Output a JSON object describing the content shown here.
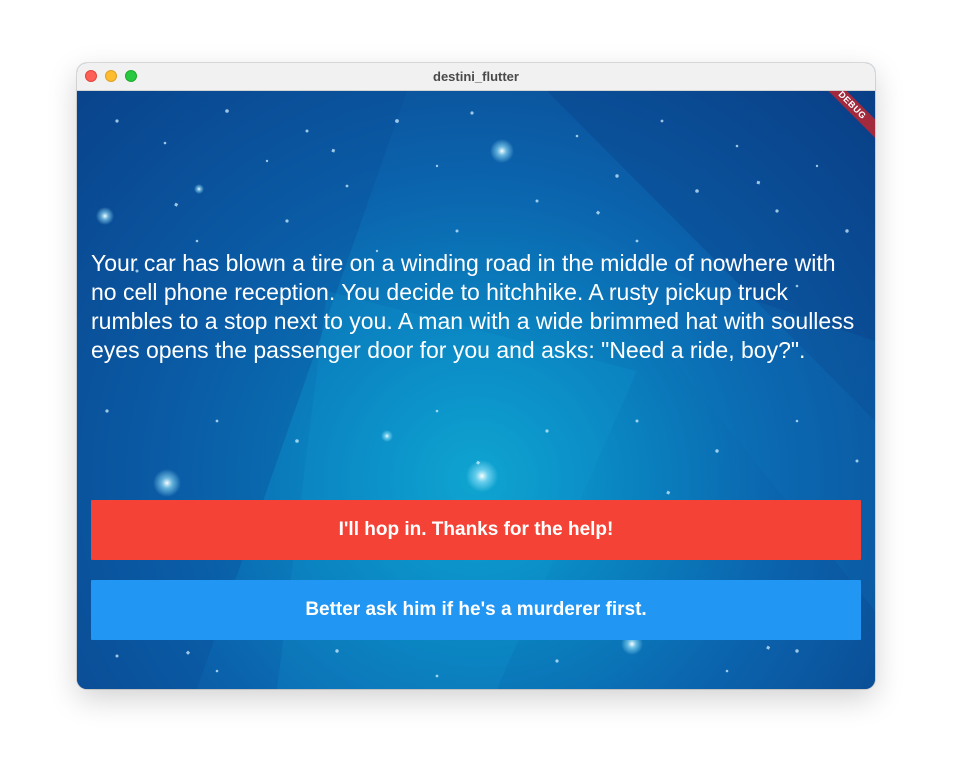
{
  "window": {
    "title": "destini_flutter",
    "controls": [
      "close",
      "minimize",
      "zoom"
    ]
  },
  "debug_banner": "DEBUG",
  "story": {
    "text": "Your car has blown a tire on a winding road in the middle of nowhere with no cell phone reception. You decide to hitchhike. A rusty pickup truck rumbles to a stop next to you. A man with a wide brimmed hat with soulless eyes opens the passenger door for you and asks: \"Need a ride, boy?\"."
  },
  "choices": {
    "choice1": {
      "label": "I'll hop in. Thanks for the help!",
      "color": "#f44336"
    },
    "choice2": {
      "label": "Better ask him if he's a murderer first.",
      "color": "#2196f3"
    }
  },
  "colors": {
    "background_center": "#0fa6cf",
    "background_edge": "#0a3f86",
    "debug_ribbon": "#a3293d"
  }
}
